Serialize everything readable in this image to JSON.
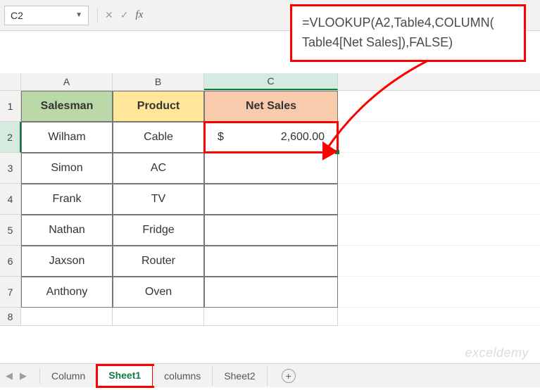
{
  "namebox": "C2",
  "formula": {
    "line1": "=VLOOKUP(A2,Table4,COLUMN(",
    "line2": "Table4[Net Sales]),FALSE)"
  },
  "colHeaders": [
    "A",
    "B",
    "C"
  ],
  "headerRow": [
    "Salesman",
    "Product",
    "Net Sales"
  ],
  "rows": [
    {
      "n": "2",
      "a": "Wilham",
      "b": "Cable",
      "c_cur": "$",
      "c_val": "2,600.00"
    },
    {
      "n": "3",
      "a": "Simon",
      "b": "AC",
      "c_cur": "",
      "c_val": ""
    },
    {
      "n": "4",
      "a": "Frank",
      "b": "TV",
      "c_cur": "",
      "c_val": ""
    },
    {
      "n": "5",
      "a": "Nathan",
      "b": "Fridge",
      "c_cur": "",
      "c_val": ""
    },
    {
      "n": "6",
      "a": "Jaxson",
      "b": "Router",
      "c_cur": "",
      "c_val": ""
    },
    {
      "n": "7",
      "a": "Anthony",
      "b": "Oven",
      "c_cur": "",
      "c_val": ""
    }
  ],
  "row8": "8",
  "tabs": {
    "t0": "Column",
    "t1": "Sheet1",
    "t2": "columns",
    "t3": "Sheet2"
  },
  "watermark": "exceldemy",
  "chart_data": {
    "type": "table",
    "title": "",
    "columns": [
      "Salesman",
      "Product",
      "Net Sales"
    ],
    "records": [
      {
        "Salesman": "Wilham",
        "Product": "Cable",
        "Net Sales": 2600.0
      },
      {
        "Salesman": "Simon",
        "Product": "AC",
        "Net Sales": null
      },
      {
        "Salesman": "Frank",
        "Product": "TV",
        "Net Sales": null
      },
      {
        "Salesman": "Nathan",
        "Product": "Fridge",
        "Net Sales": null
      },
      {
        "Salesman": "Jaxson",
        "Product": "Router",
        "Net Sales": null
      },
      {
        "Salesman": "Anthony",
        "Product": "Oven",
        "Net Sales": null
      }
    ]
  }
}
